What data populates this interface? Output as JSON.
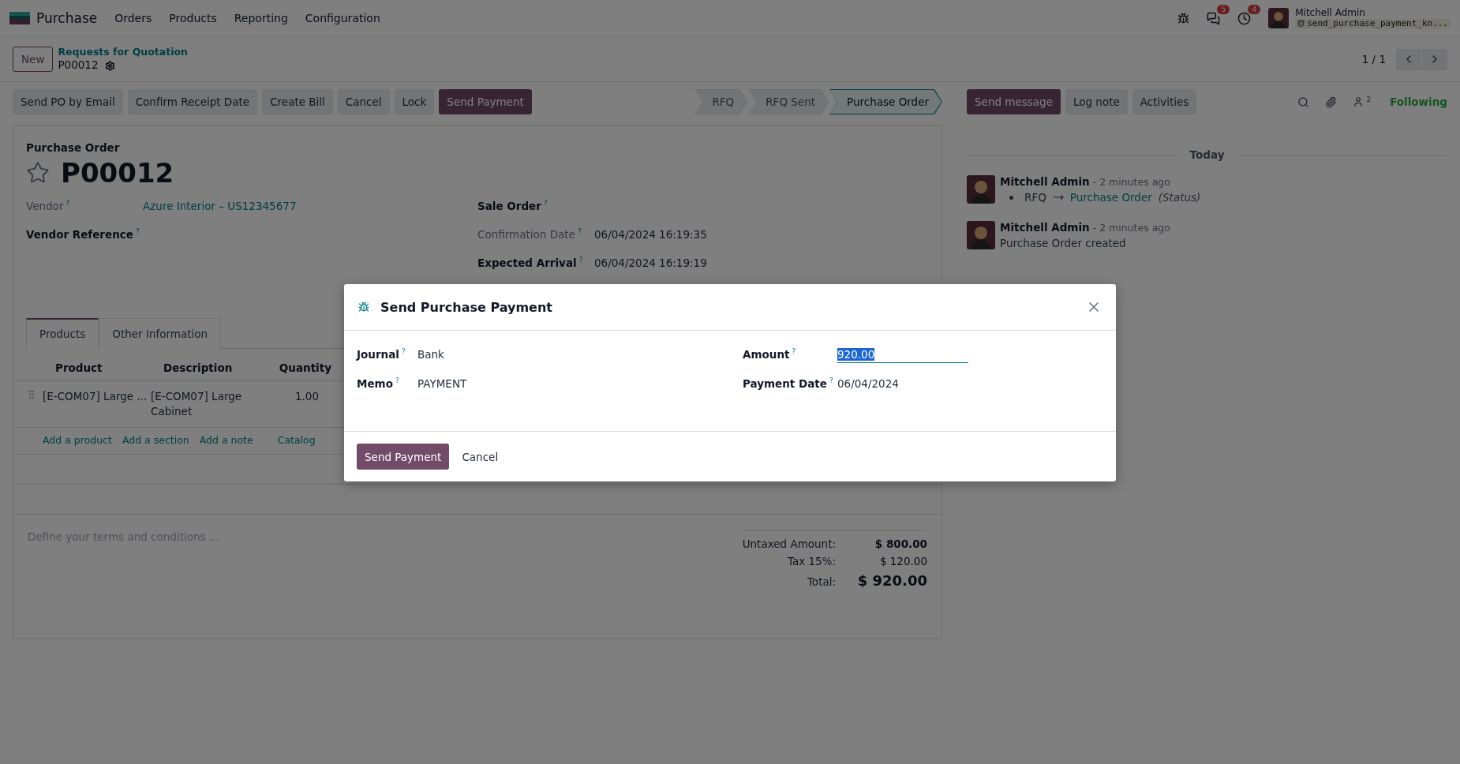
{
  "navbar": {
    "app": "Purchase",
    "menu": [
      "Orders",
      "Products",
      "Reporting",
      "Configuration"
    ],
    "messages_badge": "5",
    "activities_badge": "4",
    "user": "Mitchell Admin",
    "database": "send_purchase_payment_kn..."
  },
  "breadcrumb": {
    "new_button": "New",
    "parent": "Requests for Quotation",
    "current": "P00012"
  },
  "pager": {
    "value": "1 / 1"
  },
  "actions": [
    {
      "label": "Send PO by Email",
      "primary": false
    },
    {
      "label": "Confirm Receipt Date",
      "primary": false
    },
    {
      "label": "Create Bill",
      "primary": false
    },
    {
      "label": "Cancel",
      "primary": false
    },
    {
      "label": "Lock",
      "primary": false
    },
    {
      "label": "Send Payment",
      "primary": true
    }
  ],
  "status_steps": [
    {
      "label": "RFQ",
      "selected": false
    },
    {
      "label": "RFQ Sent",
      "selected": false
    },
    {
      "label": "Purchase Order",
      "selected": true
    }
  ],
  "form": {
    "caption": "Purchase Order",
    "name": "P00012",
    "left_fields": [
      {
        "label": "Vendor",
        "help": "?",
        "readonly": true,
        "value": "Azure Interior – US12345677",
        "kind": "link"
      },
      {
        "label": "Vendor Reference",
        "help": "?",
        "readonly": false,
        "kind": "empty"
      }
    ],
    "right_fields": [
      {
        "label": "Sale Order",
        "help": "?",
        "readonly": false,
        "kind": "empty"
      },
      {
        "label": "Confirmation Date",
        "help": "?",
        "readonly": true,
        "value": "06/04/2024 16:19:35",
        "kind": "text"
      },
      {
        "label": "Expected Arrival",
        "help": "?",
        "readonly": false,
        "value": "06/04/2024 16:19:19",
        "kind": "text"
      }
    ],
    "tabs": [
      {
        "label": "Products",
        "selected": true
      },
      {
        "label": "Other Information",
        "selected": false
      }
    ],
    "table": {
      "columns": [
        "Product",
        "Description",
        "Quantity"
      ],
      "rows": [
        [
          "[E-COM07] Large ...",
          "[E-COM07] Large Cabinet",
          "1.00"
        ]
      ]
    },
    "add_links": [
      "Add a product",
      "Add a section",
      "Add a note",
      "Catalog"
    ],
    "terms_placeholder": "Define your terms and conditions ...",
    "totals": [
      {
        "label": "Untaxed Amount:",
        "value": "$ 800.00",
        "kind": "bold"
      },
      {
        "label": "Tax 15%:",
        "value": "$ 120.00",
        "kind": "plain"
      },
      {
        "label": "Total:",
        "value": "$ 920.00",
        "kind": "grand"
      }
    ]
  },
  "chatter": {
    "buttons": [
      {
        "label": "Send message",
        "primary": true
      },
      {
        "label": "Log note",
        "primary": false
      },
      {
        "label": "Activities",
        "primary": false
      }
    ],
    "followers_count": "2",
    "follow": "Following",
    "date_separator": "Today",
    "messages": [
      {
        "author": "Mitchell Admin",
        "time": "- 2 minutes ago",
        "kind": "tracking",
        "old": "RFQ",
        "new": "Purchase Order",
        "field": "(Status)"
      },
      {
        "author": "Mitchell Admin",
        "time": "- 2 minutes ago",
        "kind": "text",
        "body": "Purchase Order created"
      }
    ]
  },
  "dialog": {
    "title": "Send Purchase Payment",
    "left_fields": [
      {
        "label": "Journal",
        "help": "?",
        "value": "Bank"
      },
      {
        "label": "Memo",
        "help": "?",
        "value": "PAYMENT"
      }
    ],
    "amount": {
      "label": "Amount",
      "help": "?",
      "value": "920.00",
      "text_selected": true
    },
    "payment_date": {
      "label": "Payment Date",
      "help": "?",
      "value": "06/04/2024"
    },
    "buttons": [
      {
        "label": "Send Payment",
        "primary": true
      },
      {
        "label": "Cancel",
        "primary": false
      }
    ]
  }
}
